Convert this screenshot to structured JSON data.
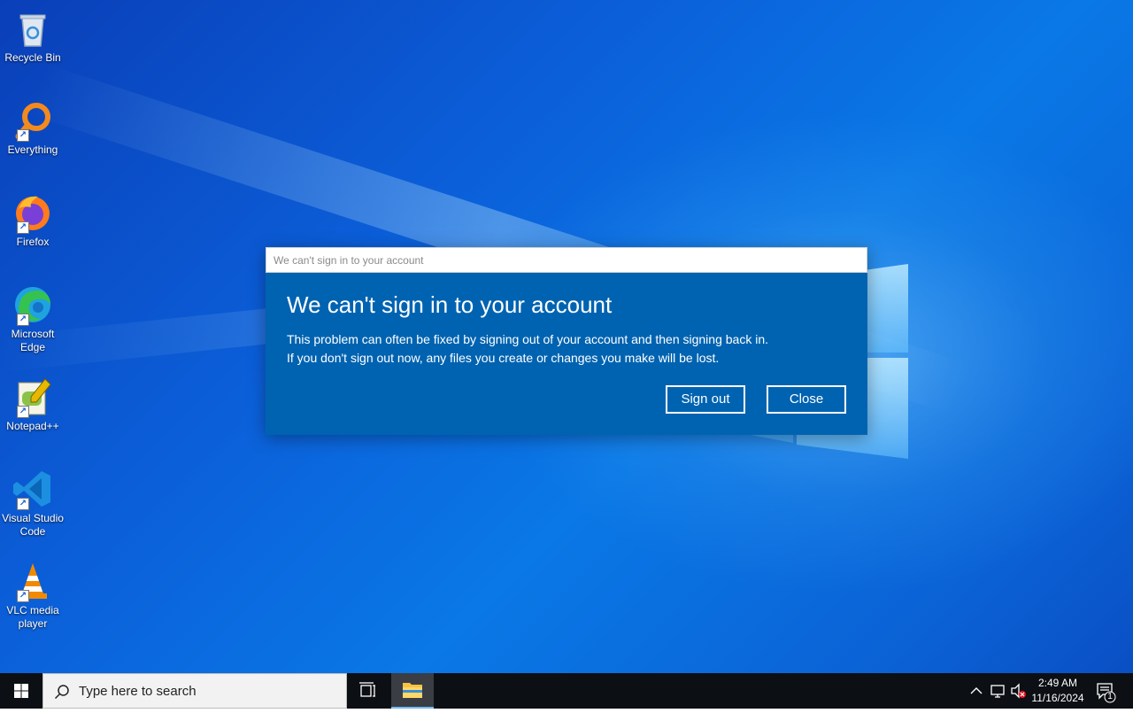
{
  "desktop": {
    "icons": [
      {
        "label": "Recycle Bin"
      },
      {
        "label": "Everything"
      },
      {
        "label": "Firefox"
      },
      {
        "label": "Microsoft Edge"
      },
      {
        "label": "Notepad++"
      },
      {
        "label": "Visual Studio Code"
      },
      {
        "label": "VLC media player"
      }
    ]
  },
  "dialog": {
    "window_title": "We can't sign in to your account",
    "heading": "We can't sign in to your account",
    "message_line1": "This problem can often be fixed by signing out of your account and then signing back in.",
    "message_line2": "If you don't sign out now, any files you create or changes you make will be lost.",
    "sign_out_label": "Sign out",
    "close_label": "Close",
    "background_color": "#0063b1"
  },
  "taskbar": {
    "search_placeholder": "Type here to search",
    "clock_time": "2:49 AM",
    "clock_date": "11/16/2024",
    "notification_count": "1",
    "icons": [
      "windows-start-icon",
      "search-icon",
      "task-view-icon",
      "file-explorer-icon",
      "chevron-up-icon",
      "network-icon",
      "volume-muted-icon",
      "action-center-icon"
    ]
  }
}
